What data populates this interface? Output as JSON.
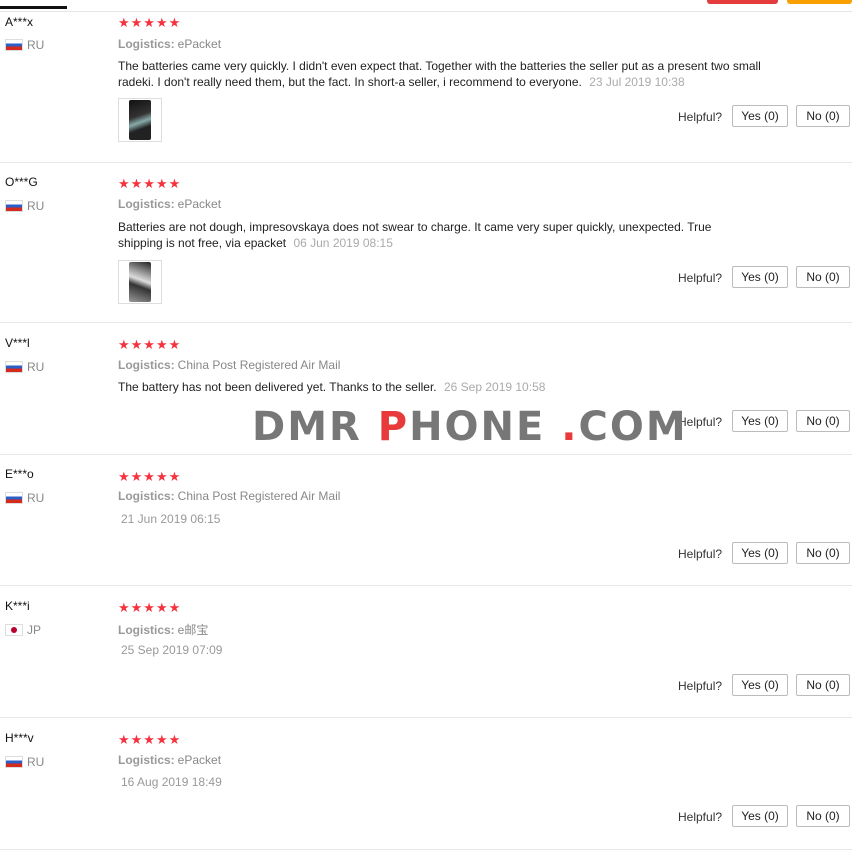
{
  "watermark": {
    "part1": "DMR ",
    "p": "P",
    "part2": "HONE ",
    "dot": ".",
    "part3": "COM"
  },
  "helpful_label": "Helpful?",
  "stars": "★★★★★",
  "logistics_label": "Logistics:",
  "reviews": [
    {
      "user": "A***x",
      "country": "RU",
      "logistics": "ePacket",
      "text": "The batteries came very quickly. I didn't even expect that. Together with the batteries the seller put as a present two small radeki. I don't really need them, but the fact. In short-a seller, i recommend to everyone.",
      "date": "23 Jul 2019 10:38",
      "yes": "Yes (0)",
      "no": "No (0)"
    },
    {
      "user": "O***G",
      "country": "RU",
      "logistics": "ePacket",
      "text": "Batteries are not dough, impresovskaya does not swear to charge. It came very super quickly, unexpected. True shipping is not free, via epacket",
      "date": "06 Jun 2019 08:15",
      "yes": "Yes (0)",
      "no": "No (0)"
    },
    {
      "user": "V***l",
      "country": "RU",
      "logistics": "China Post Registered Air Mail",
      "text": "The battery has not been delivered yet. Thanks to the seller.",
      "date": "26 Sep 2019 10:58",
      "yes": "Yes (0)",
      "no": "No (0)"
    },
    {
      "user": "E***o",
      "country": "RU",
      "logistics": "China Post Registered Air Mail",
      "date": "21 Jun 2019 06:15",
      "yes": "Yes (0)",
      "no": "No (0)"
    },
    {
      "user": "K***i",
      "country": "JP",
      "logistics": "e邮宝",
      "date": "25 Sep 2019 07:09",
      "yes": "Yes (0)",
      "no": "No (0)"
    },
    {
      "user": "H***v",
      "country": "RU",
      "logistics": "ePacket",
      "date": "16 Aug 2019 18:49",
      "yes": "Yes (0)",
      "no": "No (0)"
    }
  ]
}
